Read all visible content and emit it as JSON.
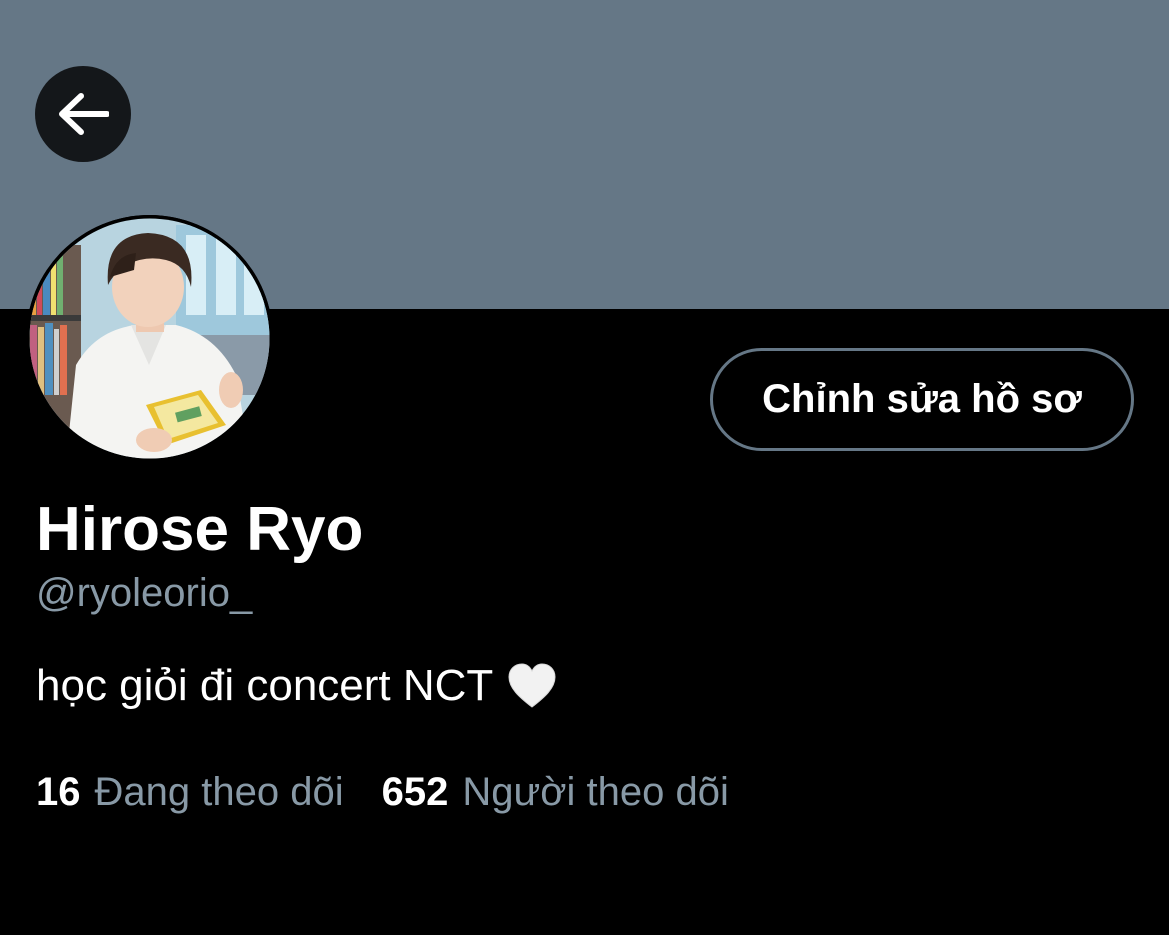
{
  "profile": {
    "display_name": "Hirose Ryo",
    "handle": "@ryoleorio_",
    "bio": "học giỏi đi concert NCT",
    "bio_emoji": "white-heart",
    "avatar_description": "profile photo"
  },
  "actions": {
    "edit_profile_label": "Chỉnh sửa hồ sơ",
    "back_icon": "arrow-left-icon"
  },
  "stats": {
    "following_count": "16",
    "following_label": "Đang theo dõi",
    "followers_count": "652",
    "followers_label": "Người theo dõi"
  },
  "colors": {
    "banner": "#657786",
    "background": "#000000",
    "secondary_text": "#8899a6",
    "button_border": "#657786"
  }
}
